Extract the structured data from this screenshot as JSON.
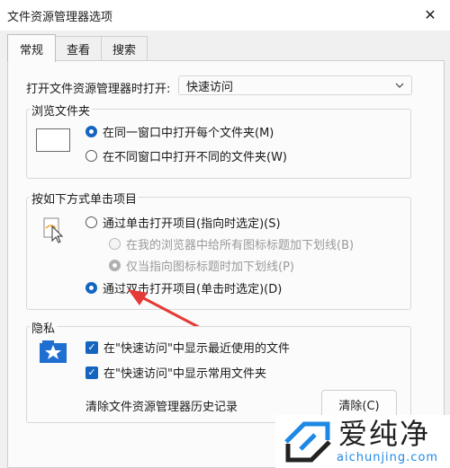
{
  "window": {
    "title": "文件资源管理器选项",
    "close_glyph": "✕"
  },
  "tabs": [
    {
      "label": "常规",
      "active": true
    },
    {
      "label": "查看",
      "active": false
    },
    {
      "label": "搜索",
      "active": false
    }
  ],
  "open_explorer": {
    "label": "打开文件资源管理器时打开:",
    "selected": "快速访问"
  },
  "browse_folders": {
    "title": "浏览文件夹",
    "options": [
      {
        "label": "在同一窗口中打开每个文件夹(M)",
        "checked": true
      },
      {
        "label": "在不同窗口中打开不同的文件夹(W)",
        "checked": false
      }
    ]
  },
  "click_items": {
    "title": "按如下方式单击项目",
    "single_click": {
      "label": "通过单击打开项目(指向时选定)(S)",
      "checked": false
    },
    "underline_all": {
      "label": "在我的浏览器中给所有图标标题加下划线(B)",
      "checked": false,
      "enabled": false
    },
    "underline_point": {
      "label": "仅当指向图标标题时加下划线(P)",
      "checked": true,
      "enabled": false
    },
    "double_click": {
      "label": "通过双击打开项目(单击时选定)(D)",
      "checked": true
    }
  },
  "privacy": {
    "title": "隐私",
    "show_recent": {
      "label": "在\"快速访问\"中显示最近使用的文件",
      "checked": true
    },
    "show_frequent": {
      "label": "在\"快速访问\"中显示常用文件夹",
      "checked": true
    },
    "clear_label": "清除文件资源管理器历史记录",
    "clear_button": "清除(C)"
  },
  "watermark": {
    "brand": "爱纯净",
    "url": "aichunjing.com"
  },
  "colors": {
    "accent": "#1565c0",
    "arrow": "#e53935",
    "watermark_blue": "#1e88e5"
  }
}
